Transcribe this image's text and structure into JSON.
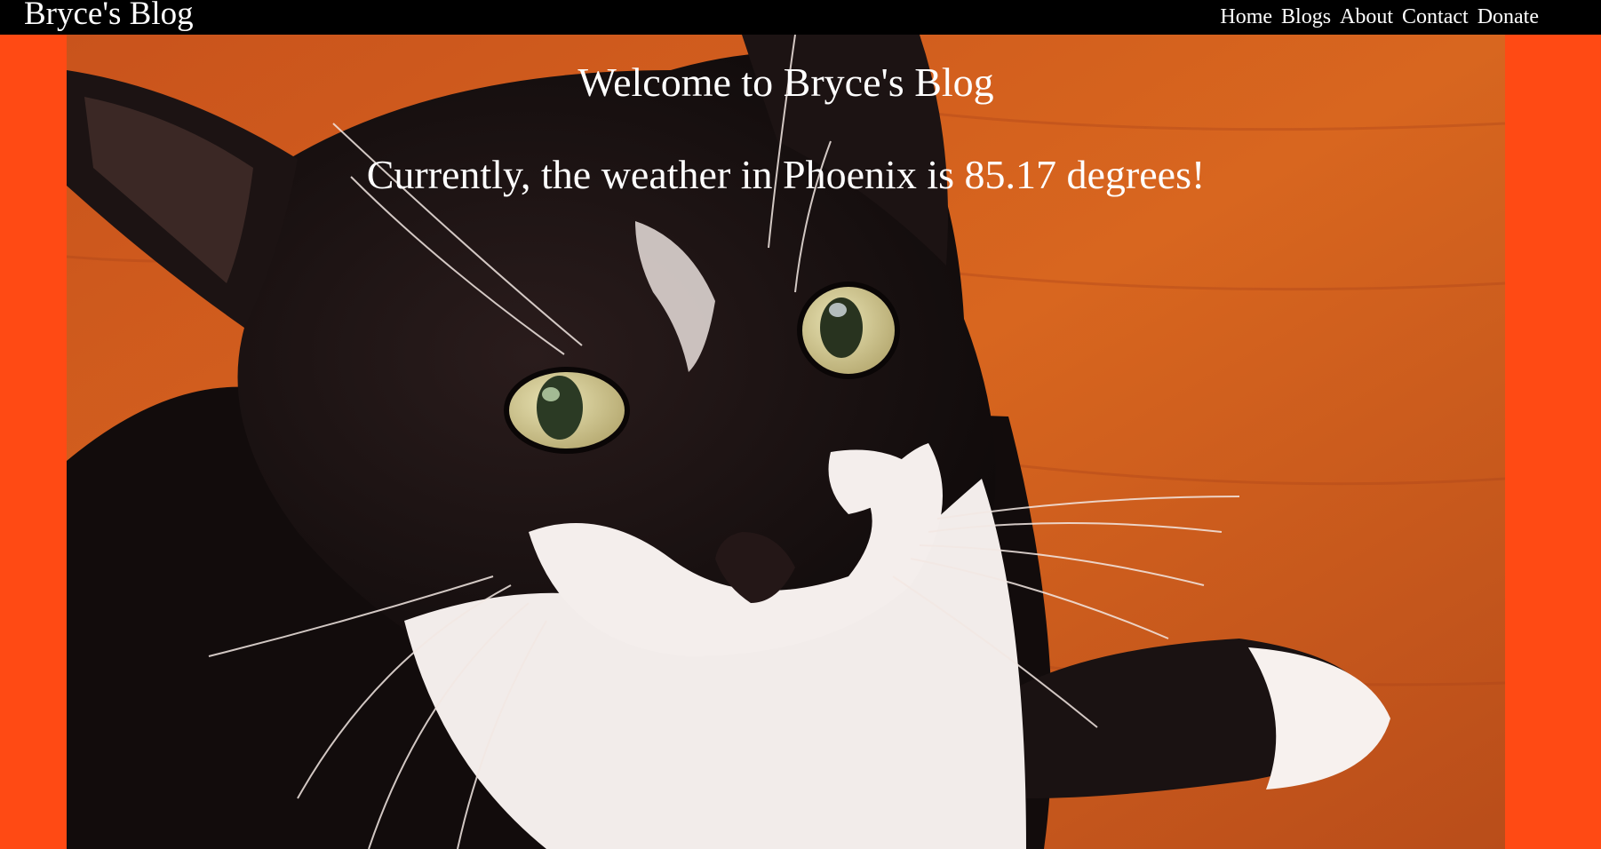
{
  "header": {
    "brand": "Bryce's Blog",
    "nav": [
      "Home",
      "Blogs",
      "About",
      "Contact",
      "Donate"
    ]
  },
  "hero": {
    "welcome": "Welcome to Bryce's Blog",
    "weather": "Currently, the weather in Phoenix is 85.17 degrees!",
    "image_subject": "black-and-white cat on orange wooden floor"
  },
  "colors": {
    "page_background": "#ff4a14",
    "topbar": "#000000",
    "text": "#ffffff"
  }
}
